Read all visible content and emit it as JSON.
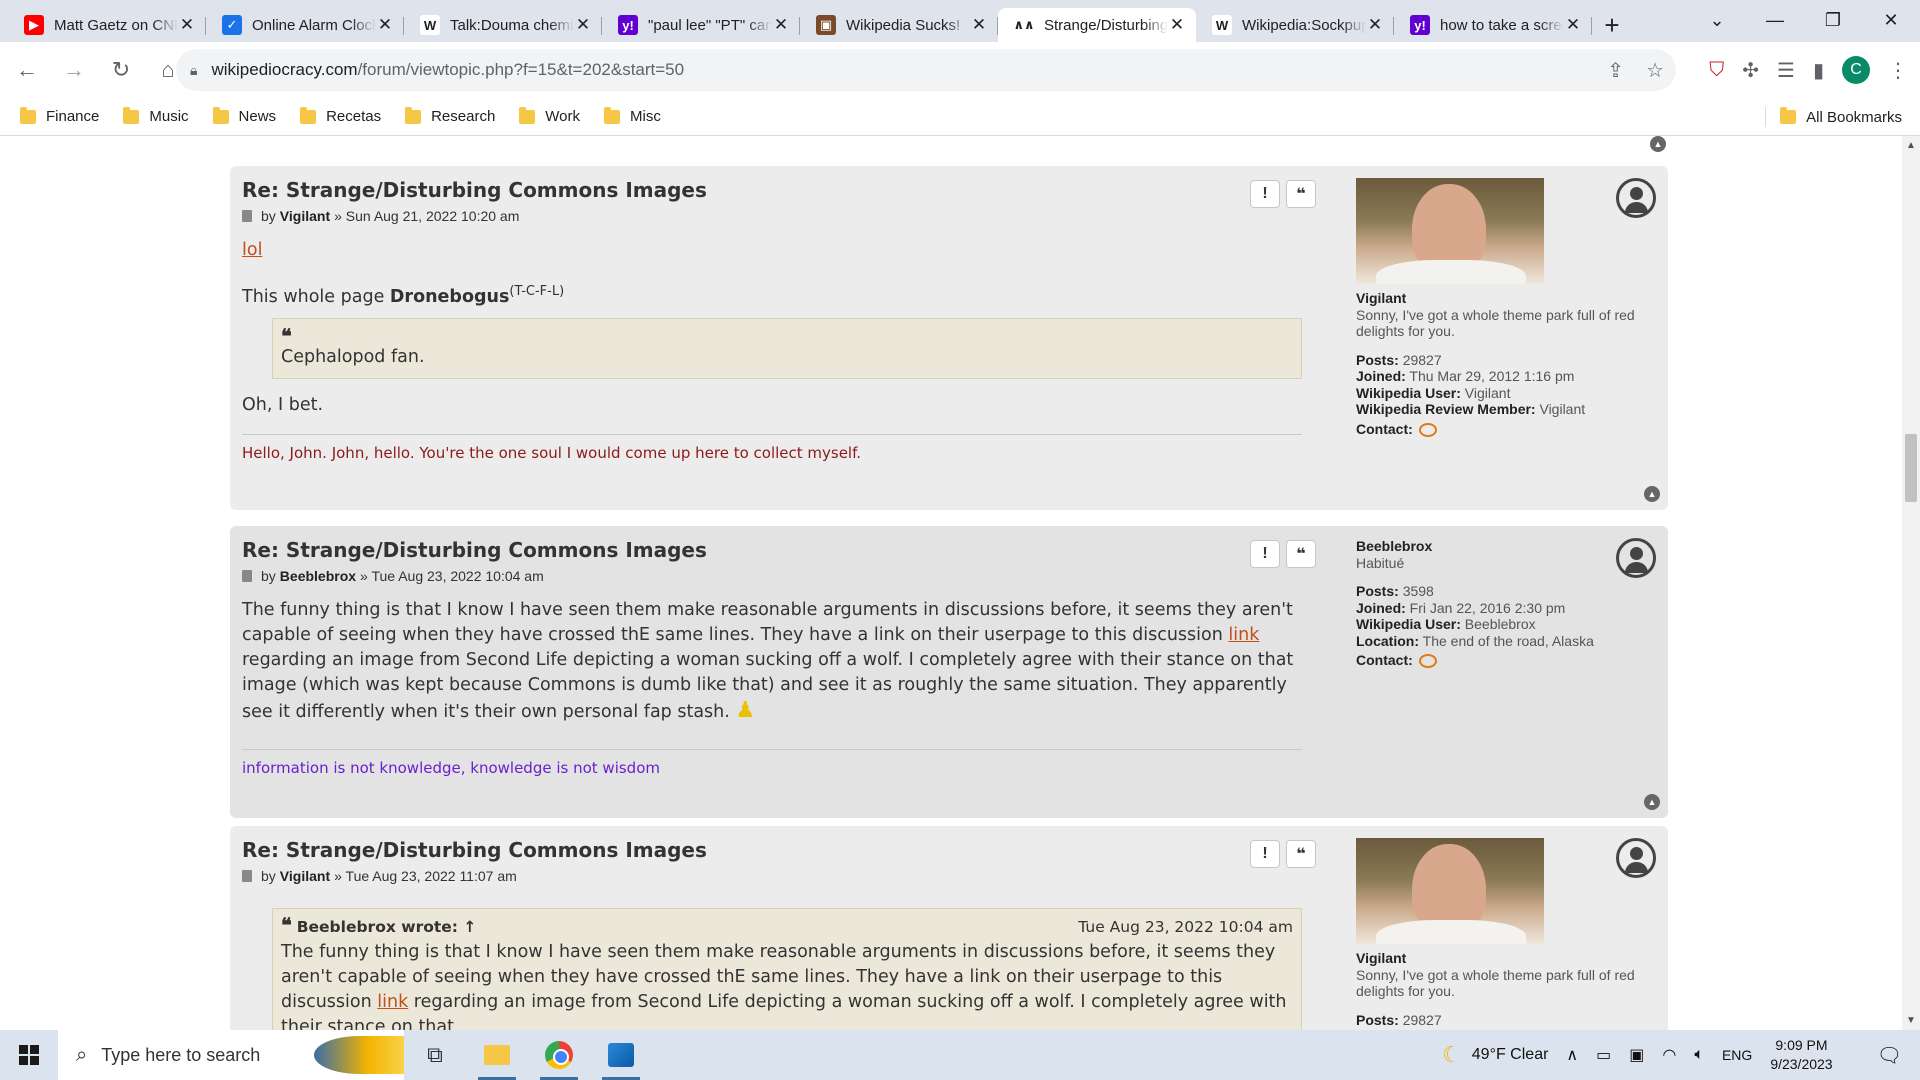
{
  "browser": {
    "tabs": [
      {
        "title": "Matt Gaetz on CNN",
        "icon": "youtube-icon",
        "color": "#ff0000",
        "glyph": "▶"
      },
      {
        "title": "Online Alarm Clock",
        "icon": "clock-icon",
        "color": "#1a73e8",
        "glyph": "✓"
      },
      {
        "title": "Talk:Douma chemical",
        "icon": "wikipedia-icon",
        "color": "#ffffff",
        "glyph": "W"
      },
      {
        "title": "\"paul lee\" \"PT\" camp",
        "icon": "yahoo-icon",
        "color": "#6001d2",
        "glyph": "y!"
      },
      {
        "title": "Wikipedia Sucks!",
        "icon": "site-icon",
        "color": "#7a4b2a",
        "glyph": "▣"
      },
      {
        "title": "Strange/Disturbing",
        "icon": "wikipediocracy-icon",
        "color": "#ffffff",
        "glyph": "∧∧"
      },
      {
        "title": "Wikipedia:Sockpuppetry",
        "icon": "wikipedia-icon",
        "color": "#ffffff",
        "glyph": "W"
      },
      {
        "title": "how to take a screenshot",
        "icon": "yahoo-icon",
        "color": "#6001d2",
        "glyph": "y!"
      }
    ],
    "active_tab": 5,
    "url_host": "wikipediocracy.com",
    "url_path": "/forum/viewtopic.php?f=15&t=202&start=50",
    "profile_initial": "C",
    "bookmarks": [
      "Finance",
      "Music",
      "News",
      "Recetas",
      "Research",
      "Work",
      "Misc"
    ],
    "all_bookmarks": "All Bookmarks"
  },
  "posts": [
    {
      "title": "Re: Strange/Disturbing Commons Images",
      "by": "by",
      "author": "Vigilant",
      "date": "» Sun Aug 21, 2022 10:20 am",
      "line1_link": "lol",
      "line2_pre": "This whole page ",
      "line2_bold": "Dronebogus",
      "line2_sup": "(T-C-F-L)",
      "quote": "Cephalopod fan.",
      "line3": "Oh, I bet.",
      "signature": "Hello, John. John, hello. You're the one soul I would come up here to collect myself.",
      "signature_color": "#8b1a1a",
      "profile": {
        "name": "Vigilant",
        "rank": "Sonny, I've got a whole theme park full of red delights for you.",
        "posts_label": "Posts:",
        "posts": "29827",
        "joined_label": "Joined:",
        "joined": "Thu Mar 29, 2012 1:16 pm",
        "wpuser_label": "Wikipedia User:",
        "wpuser": "Vigilant",
        "wrm_label": "Wikipedia Review Member:",
        "wrm": "Vigilant",
        "contact_label": "Contact:"
      }
    },
    {
      "title": "Re: Strange/Disturbing Commons Images",
      "by": "by",
      "author": "Beeblebrox",
      "date": "» Tue Aug 23, 2022 10:04 am",
      "text_a": "The funny thing is that I know I have seen them make reasonable arguments in discussions before, it seems they aren't capable of seeing when they have crossed thE same lines. They have a link on their userpage to this discussion ",
      "text_link": "link",
      "text_b": " regarding an image from Second Life depicting a woman sucking off a wolf. I completely agree with their stance on that image (which was kept because Commons is dumb like that) and see it as roughly the same situation. They apparently see it differently when it's their own personal fap stash.",
      "signature": "information is not knowledge, knowledge is not wisdom",
      "signature_color": "#6a1fd0",
      "profile": {
        "name": "Beeblebrox",
        "rank": "Habitué",
        "posts_label": "Posts:",
        "posts": "3598",
        "joined_label": "Joined:",
        "joined": "Fri Jan 22, 2016 2:30 pm",
        "wpuser_label": "Wikipedia User:",
        "wpuser": "Beeblebrox",
        "location_label": "Location:",
        "location": "The end of the road, Alaska",
        "contact_label": "Contact:"
      }
    },
    {
      "title": "Re: Strange/Disturbing Commons Images",
      "by": "by",
      "author": "Vigilant",
      "date": "» Tue Aug 23, 2022 11:07 am",
      "quote_author": "Beeblebrox wrote: ↑",
      "quote_date": "Tue Aug 23, 2022 10:04 am",
      "quote_a": "The funny thing is that I know I have seen them make reasonable arguments in discussions before, it seems they aren't capable of seeing when they have crossed thE same lines. They have a link on their userpage to this discussion ",
      "quote_link": "link",
      "quote_b": " regarding an image from Second Life depicting a woman sucking off a wolf. I completely agree with their stance on that",
      "profile": {
        "name": "Vigilant",
        "rank": "Sonny, I've got a whole theme park full of red delights for you.",
        "posts_label": "Posts:",
        "posts": "29827"
      }
    }
  ],
  "taskbar": {
    "search_placeholder": "Type here to search",
    "weather": "49°F  Clear",
    "lang": "ENG",
    "time": "9:09 PM",
    "date": "9/23/2023"
  }
}
